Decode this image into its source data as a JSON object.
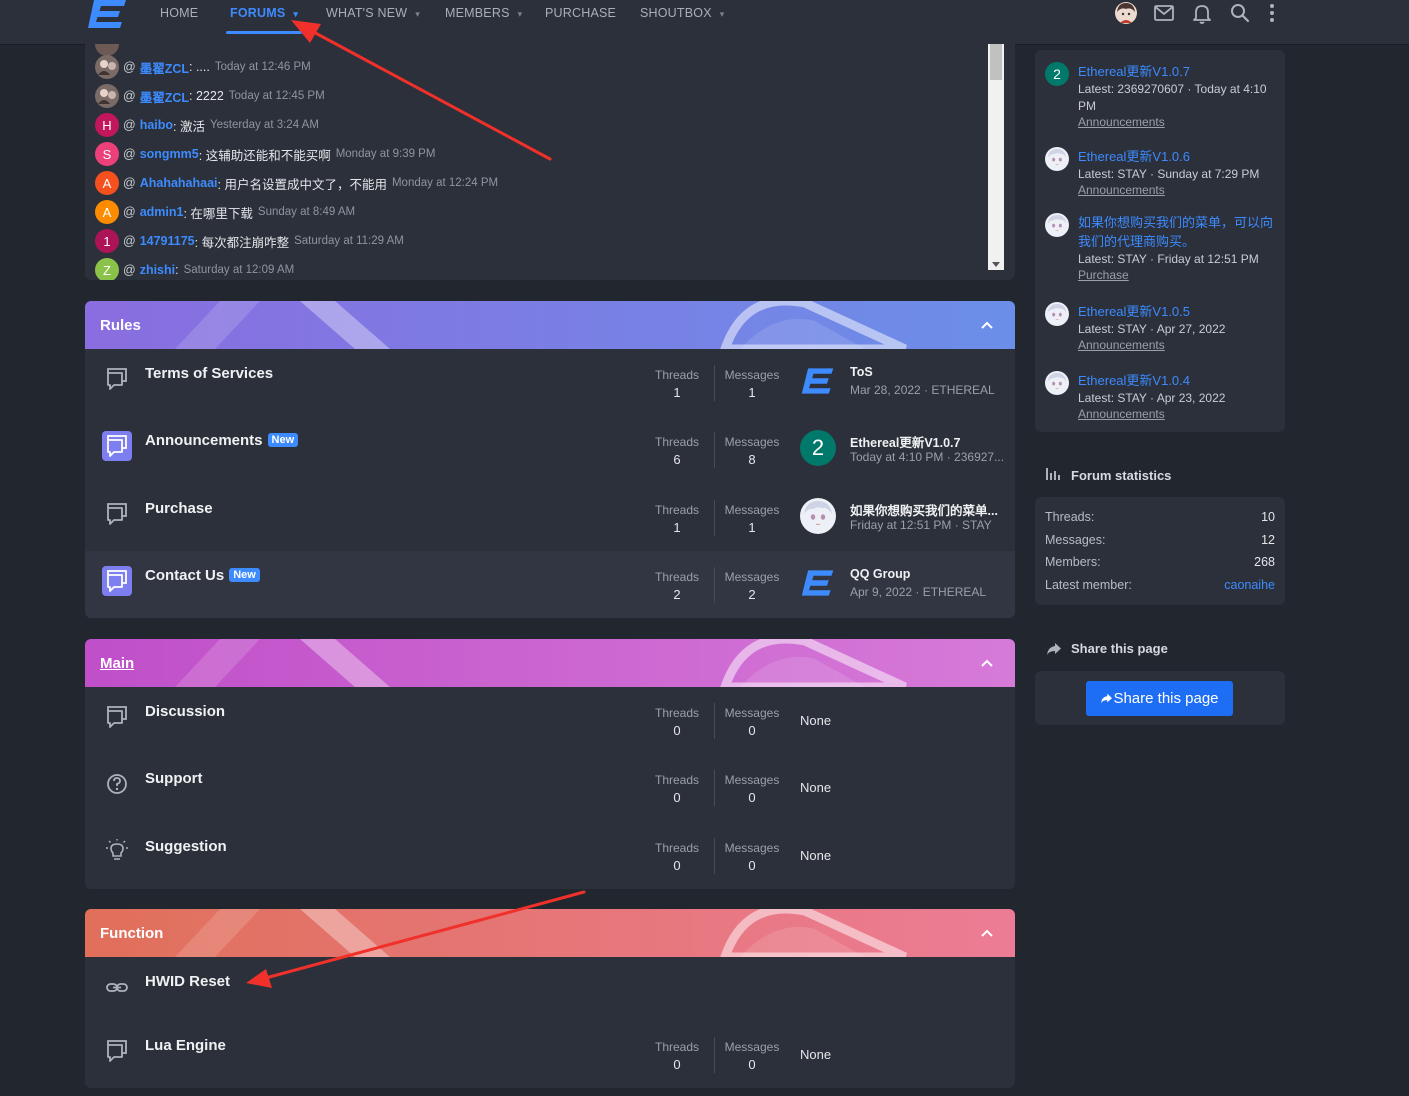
{
  "nav": {
    "items": [
      {
        "label": "HOME",
        "caret": false,
        "active": false
      },
      {
        "label": "FORUMS",
        "caret": true,
        "active": true
      },
      {
        "label": "WHAT'S NEW",
        "caret": true,
        "active": false
      },
      {
        "label": "MEMBERS",
        "caret": true,
        "active": false
      },
      {
        "label": "PURCHASE",
        "caret": false,
        "active": false
      },
      {
        "label": "SHOUTBOX",
        "caret": true,
        "active": false
      }
    ],
    "icons": [
      "avatar",
      "mail-icon",
      "bell-icon",
      "search-icon",
      "more-vertical-icon"
    ]
  },
  "shoutbox": {
    "messages": [
      {
        "avatar_type": "image",
        "user": "墨翟ZCL",
        "text": ": ....",
        "time": "Today at 12:46 PM"
      },
      {
        "avatar_type": "image",
        "user": "墨翟ZCL",
        "text": ": 2222",
        "time": "Today at 12:45 PM"
      },
      {
        "avatar_letter": "H",
        "avatar_color": "#c2185b",
        "user": "haibo",
        "text": ": 激活",
        "time": "Yesterday at 3:24 AM"
      },
      {
        "avatar_letter": "S",
        "avatar_color": "#ec407a",
        "user": "songmm5",
        "text": ": 这辅助还能和不能买啊",
        "time": "Monday at 9:39 PM"
      },
      {
        "avatar_letter": "A",
        "avatar_color": "#f4511e",
        "user": "Ahahahahaai",
        "text": ": 用户名设置成中文了，不能用",
        "time": "Monday at 12:24 PM"
      },
      {
        "avatar_letter": "A",
        "avatar_color": "#fb8c00",
        "user": "admin1",
        "text": ": 在哪里下载",
        "time": "Sunday at 8:49 AM"
      },
      {
        "avatar_letter": "1",
        "avatar_color": "#ad1457",
        "user": "14791175",
        "text": ": 每次都注崩咋整",
        "time": "Saturday at 11:29 AM"
      },
      {
        "avatar_letter": "Z",
        "avatar_color": "#8bc34a",
        "user": "zhishi",
        "text": ":",
        "time": "Saturday at 12:09 AM"
      }
    ]
  },
  "labels": {
    "threads": "Threads",
    "messages": "Messages",
    "none": "None",
    "new_badge": "New"
  },
  "categories": [
    {
      "title": "Rules",
      "title_underlined": false,
      "gradient": [
        "#8a6de0",
        "#6b8fe8"
      ],
      "nodes": [
        {
          "title": "Terms of Services",
          "icon": "forum-icon",
          "icon_highlight": false,
          "is_new": false,
          "threads": "1",
          "messages": "1",
          "last": {
            "avatar": "logo",
            "title": "ToS",
            "meta": "Mar 28, 2022 · ETHEREAL"
          }
        },
        {
          "title": "Announcements",
          "icon": "forum-icon",
          "icon_highlight": true,
          "is_new": true,
          "threads": "6",
          "messages": "8",
          "last": {
            "avatar": "letter",
            "letter": "2",
            "color": "#00796b",
            "title": "Ethereal更新V1.0.7",
            "meta": "Today at 4:10 PM · 236927..."
          }
        },
        {
          "title": "Purchase",
          "icon": "forum-icon",
          "icon_highlight": false,
          "is_new": false,
          "threads": "1",
          "messages": "1",
          "last": {
            "avatar": "anime",
            "title": "如果你想购买我们的菜单...",
            "meta": "Friday at 12:51 PM · STAY"
          }
        },
        {
          "title": "Contact Us",
          "icon": "forum-icon",
          "icon_highlight": true,
          "is_new": true,
          "threads": "2",
          "messages": "2",
          "last": {
            "avatar": "logo",
            "title": "QQ Group",
            "meta": "Apr 9, 2022 · ETHEREAL"
          }
        }
      ]
    },
    {
      "title": "Main",
      "title_underlined": true,
      "gradient": [
        "#c04fc9",
        "#d67ad8"
      ],
      "nodes": [
        {
          "title": "Discussion",
          "icon": "forum-icon",
          "threads": "0",
          "messages": "0"
        },
        {
          "title": "Support",
          "icon": "question-icon",
          "threads": "0",
          "messages": "0"
        },
        {
          "title": "Suggestion",
          "icon": "lightbulb-icon",
          "threads": "0",
          "messages": "0"
        }
      ]
    },
    {
      "title": "Function",
      "title_underlined": false,
      "gradient": [
        "#e0705a",
        "#ec7c95"
      ],
      "nodes": [
        {
          "title": "HWID Reset",
          "icon": "link-icon",
          "link_forum": true
        },
        {
          "title": "Lua Engine",
          "icon": "forum-icon",
          "threads": "0",
          "messages": "0"
        }
      ]
    }
  ],
  "sidebar": {
    "latest_threads": [
      {
        "avatar": "letter",
        "letter": "2",
        "color": "#00796b",
        "title": "Ethereal更新V1.0.7",
        "meta": "Latest: 2369270607 · Today at 4:10 PM",
        "forum": "Announcements"
      },
      {
        "avatar": "anime",
        "title": "Ethereal更新V1.0.6",
        "meta": "Latest: STAY · Sunday at 7:29 PM",
        "forum": "Announcements"
      },
      {
        "avatar": "anime",
        "title": "如果你想购买我们的菜单，可以向我们的代理商购买。",
        "meta": "Latest: STAY · Friday at 12:51 PM",
        "forum": "Purchase"
      },
      {
        "avatar": "anime",
        "title": "Ethereal更新V1.0.5",
        "meta": "Latest: STAY · Apr 27, 2022",
        "forum": "Announcements"
      },
      {
        "avatar": "anime",
        "title": "Ethereal更新V1.0.4",
        "meta": "Latest: STAY · Apr 23, 2022",
        "forum": "Announcements"
      }
    ],
    "forum_statistics": {
      "heading": "Forum statistics",
      "rows": [
        {
          "label": "Threads:",
          "value": "10"
        },
        {
          "label": "Messages:",
          "value": "12"
        },
        {
          "label": "Members:",
          "value": "268"
        },
        {
          "label": "Latest member:",
          "value": "caonaihe"
        }
      ]
    },
    "share": {
      "heading": "Share this page",
      "button": "Share this page"
    }
  },
  "colors": {
    "accent": "#3d8bff",
    "annotation": "#f0302a",
    "page_bg": "#22262e",
    "block_bg": "#2b303a"
  }
}
